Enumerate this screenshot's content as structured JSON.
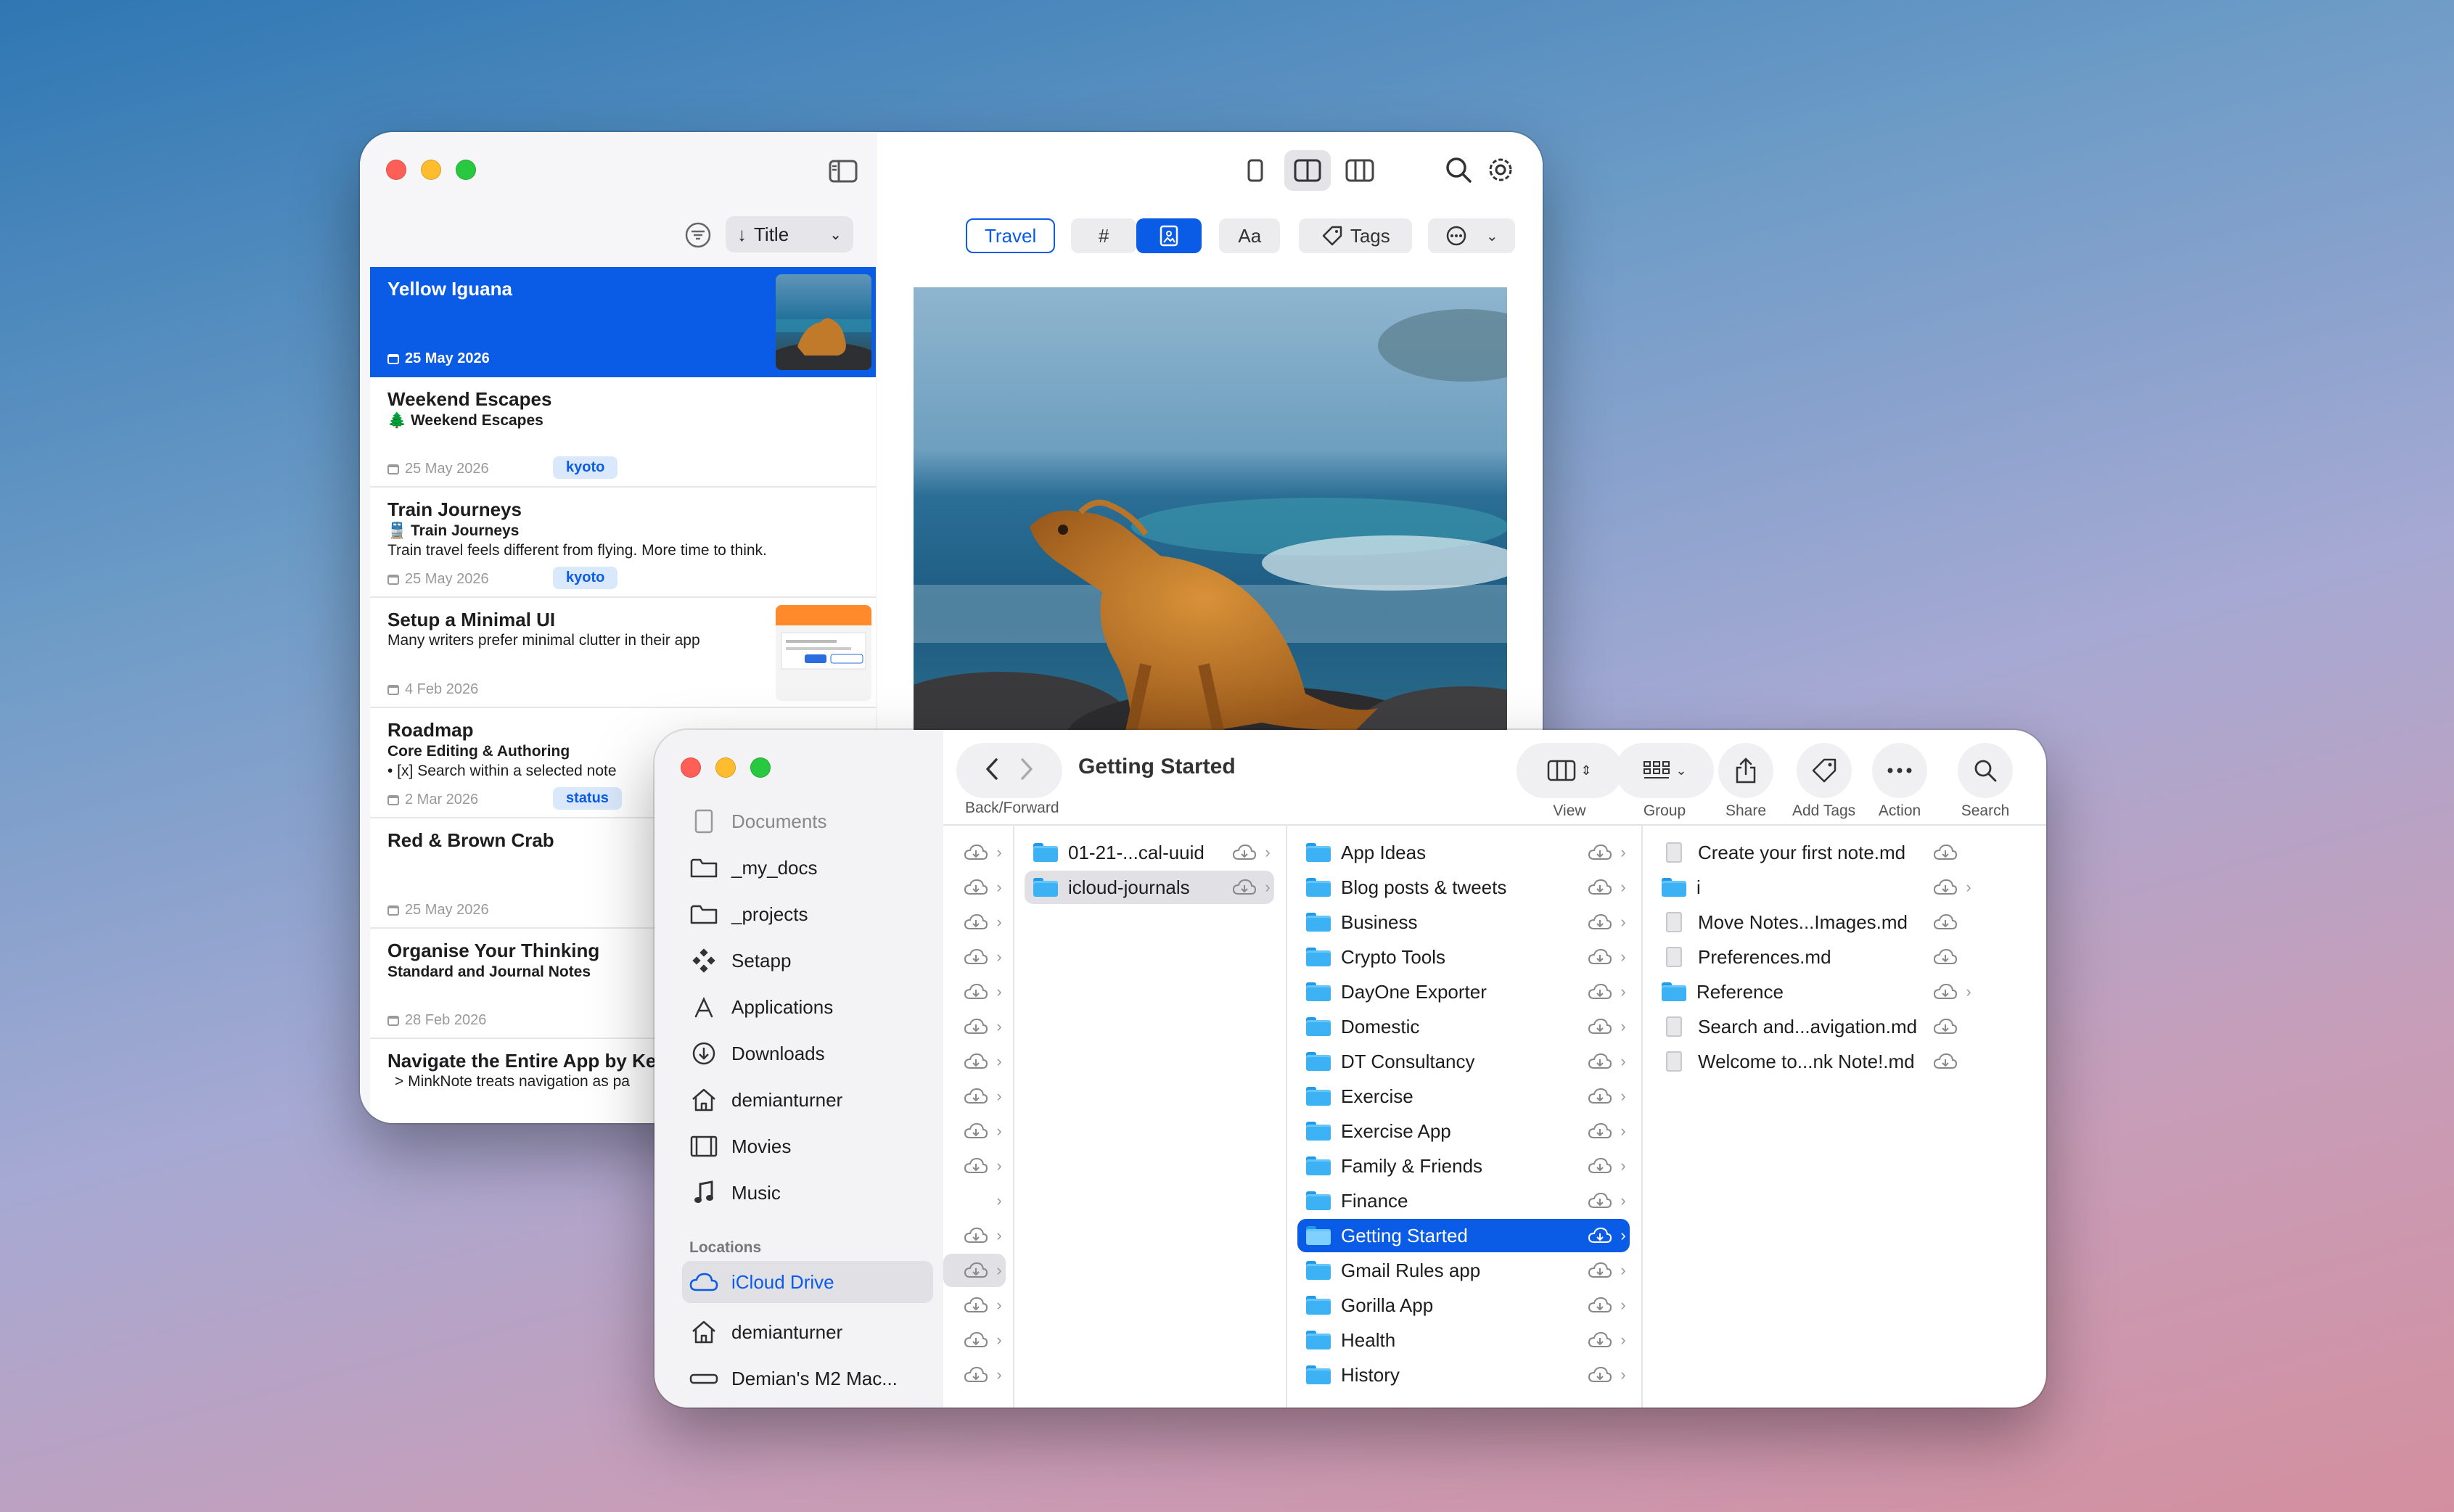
{
  "notes_window": {
    "sort": {
      "label": "Title"
    },
    "toolbar": {
      "travel_tag": "Travel",
      "hash": "#",
      "format": "Aa",
      "tags": "Tags"
    },
    "notes": [
      {
        "title": "Yellow Iguana",
        "sub1": "",
        "sub2": "",
        "date": "25 May 2026",
        "tag": ""
      },
      {
        "title": "Weekend Escapes",
        "sub1": "🌲 Weekend Escapes",
        "sub2": "",
        "date": "25 May 2026",
        "tag": "kyoto"
      },
      {
        "title": "Train Journeys",
        "sub1": "🚆 Train Journeys",
        "sub2": "Train travel feels different from flying. More time to think.",
        "date": "25 May 2026",
        "tag": "kyoto"
      },
      {
        "title": "Setup a Minimal UI",
        "sub1": "",
        "sub2": "Many writers prefer minimal clutter in their app",
        "date": "4 Feb 2026",
        "tag": ""
      },
      {
        "title": "Roadmap",
        "sub1": "Core Editing & Authoring",
        "sub2": "•  [x] Search within a selected note",
        "date": "2 Mar 2026",
        "tag": "status"
      },
      {
        "title": "Red & Brown Crab",
        "sub1": "",
        "sub2": "",
        "date": "25 May 2026",
        "tag": ""
      },
      {
        "title": "Organise Your Thinking",
        "sub1": "Standard and Journal Notes",
        "sub2": "",
        "date": "28 Feb 2026",
        "tag": ""
      },
      {
        "title": "Navigate the Entire App by Ke",
        "sub1": "",
        "sub2": "> MinkNote treats navigation as pa",
        "date": "",
        "tag": ""
      }
    ]
  },
  "finder": {
    "title": "Getting Started",
    "back_forward_label": "Back/Forward",
    "toolbar": {
      "view": "View",
      "group": "Group",
      "share": "Share",
      "add_tags": "Add Tags",
      "action": "Action",
      "search": "Search"
    },
    "sidebar": {
      "items": [
        "Documents",
        "_my_docs",
        "_projects",
        "Setapp",
        "Applications",
        "Downloads",
        "demianturner",
        "Movies",
        "Music"
      ],
      "locations_header": "Locations",
      "locations": [
        "iCloud Drive",
        "demianturner",
        "Demian's M2 Mac..."
      ]
    },
    "col1": [
      "01-21-...cal-uuid",
      "icloud-journals"
    ],
    "col2": [
      "App Ideas",
      "Blog posts & tweets",
      "Business",
      "Crypto Tools",
      "DayOne Exporter",
      "Domestic",
      "DT Consultancy",
      "Exercise",
      "Exercise App",
      "Family & Friends",
      "Finance",
      "Getting Started",
      "Gmail Rules app",
      "Gorilla App",
      "Health",
      "History"
    ],
    "col3": [
      {
        "name": "Create your first note.md",
        "kind": "doc"
      },
      {
        "name": "i",
        "kind": "folder"
      },
      {
        "name": "Move Notes...Images.md",
        "kind": "doc"
      },
      {
        "name": "Preferences.md",
        "kind": "doc"
      },
      {
        "name": "Reference",
        "kind": "folder"
      },
      {
        "name": "Search and...avigation.md",
        "kind": "doc"
      },
      {
        "name": "Welcome to...nk Note!.md",
        "kind": "doc"
      }
    ]
  },
  "colors": {
    "accent": "#0a5be6",
    "close": "#ff5f57",
    "minimize": "#febc2e",
    "zoom": "#28c840",
    "folder": "#3cb1f4"
  }
}
